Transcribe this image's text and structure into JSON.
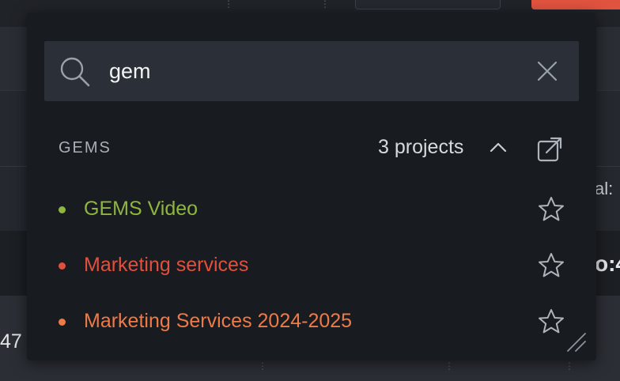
{
  "background": {
    "left_fragment_text": "47",
    "right_fragment_text_1": "al:",
    "right_fragment_text_2": "o:4"
  },
  "search": {
    "value": "gem",
    "placeholder": ""
  },
  "group": {
    "name": "GEMS",
    "count_label": "3 projects"
  },
  "projects": [
    {
      "name": "GEMS Video",
      "color": "#8fb63f"
    },
    {
      "name": "Marketing services",
      "color": "#e2503d"
    },
    {
      "name": "Marketing Services 2024-2025",
      "color": "#ee7a48"
    }
  ],
  "colors": {
    "accent_red": "#e0533f",
    "popup_bg": "#181b1f",
    "search_bg": "#2b3038"
  },
  "icons": [
    "search-icon",
    "close-icon",
    "chevron-up-icon",
    "external-link-icon",
    "star-icon",
    "resize-grip-icon"
  ]
}
